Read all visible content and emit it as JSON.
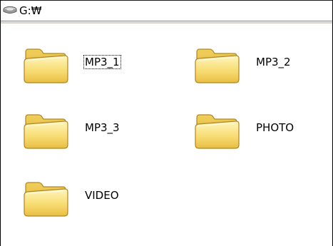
{
  "address_bar": {
    "path": "G:₩",
    "icon": "drive-icon"
  },
  "items": [
    {
      "label": "MP3_1",
      "icon": "folder-icon",
      "focused": true
    },
    {
      "label": "MP3_2",
      "icon": "folder-icon",
      "focused": false
    },
    {
      "label": "MP3_3",
      "icon": "folder-icon",
      "focused": false
    },
    {
      "label": "PHOTO",
      "icon": "folder-icon",
      "focused": false
    },
    {
      "label": "VIDEO",
      "icon": "folder-icon",
      "focused": false
    }
  ],
  "colors": {
    "folder_body": "#f6d86a",
    "folder_back": "#e8bf45",
    "folder_outline": "#b8912c"
  }
}
